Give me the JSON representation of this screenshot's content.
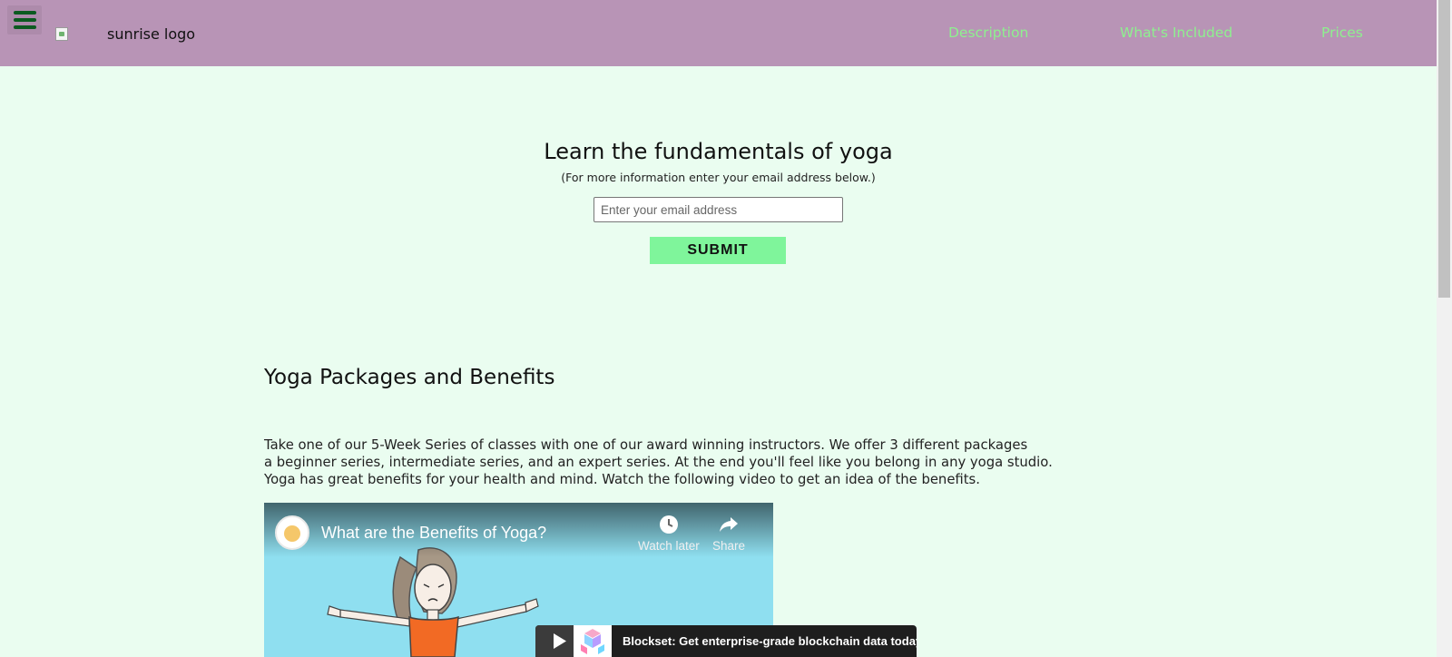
{
  "header": {
    "logo_alt": "sunrise logo",
    "nav": [
      "Description",
      "What's Included",
      "Prices"
    ]
  },
  "hero": {
    "title": "Learn the fundamentals of yoga",
    "subtitle": "(For more information enter your email address below.)",
    "email_placeholder": "Enter your email address",
    "submit_label": "SUBMIT"
  },
  "section": {
    "title": "Yoga Packages and Benefits",
    "paragraph_lines": [
      "Take one of our 5-Week Series of classes with one of our award winning instructors. We offer 3 different packages",
      "a beginner series, intermediate series, and an expert series. At the end you'll feel like you belong in any yoga studio.",
      "Yoga has great benefits for your health and mind. Watch the following video to get an idea of the benefits."
    ]
  },
  "video": {
    "title": "What are the Benefits of Yoga?",
    "watch_later": "Watch later",
    "share": "Share",
    "ad_text": "Blockset: Get enterprise-grade blockchain data today."
  },
  "colors": {
    "header_bg": "#b894b6",
    "page_bg": "#eafdf0",
    "nav_link": "#8ef08f",
    "submit_bg": "#7ff59b",
    "menu_icon": "#0b5a20"
  }
}
